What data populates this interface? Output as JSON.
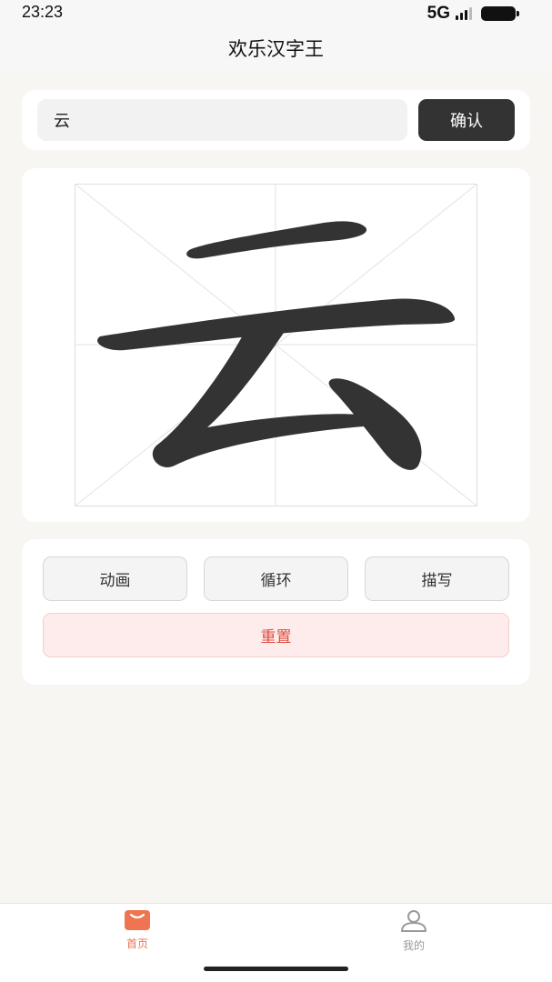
{
  "status_bar": {
    "time": "23:23",
    "network": "5G",
    "icons": [
      "signal-icon",
      "battery-icon"
    ]
  },
  "header": {
    "title": "欢乐汉字王"
  },
  "search": {
    "value": "云",
    "confirm_label": "确认"
  },
  "character": {
    "glyph": "云",
    "stroke_color": "#333333",
    "grid": "米字格"
  },
  "controls": {
    "buttons": [
      {
        "label": "动画"
      },
      {
        "label": "循环"
      },
      {
        "label": "描写"
      }
    ],
    "reset_label": "重置"
  },
  "tab_bar": {
    "tabs": [
      {
        "label": "首页",
        "icon": "home-bag-icon",
        "active": true
      },
      {
        "label": "我的",
        "icon": "user-icon",
        "active": false
      }
    ]
  },
  "colors": {
    "accent": "#ee7452",
    "danger": "#e04c3f",
    "dark_button": "#333333",
    "background": "#f7f6f3"
  }
}
